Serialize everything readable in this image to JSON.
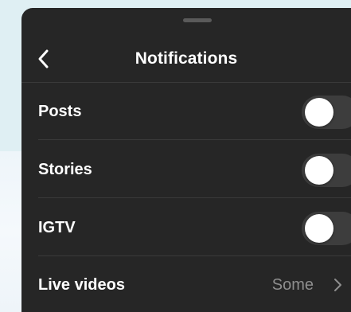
{
  "header": {
    "title": "Notifications",
    "back_icon": "chevron-left-icon"
  },
  "rows": [
    {
      "label": "Posts",
      "control": "toggle",
      "on": false
    },
    {
      "label": "Stories",
      "control": "toggle",
      "on": false
    },
    {
      "label": "IGTV",
      "control": "toggle",
      "on": false
    },
    {
      "label": "Live videos",
      "control": "disclosure",
      "value": "Some",
      "icon": "chevron-right-icon"
    }
  ],
  "colors": {
    "sheet_background": "#262626",
    "divider": "#3a3a3a",
    "toggle_off_track": "#3d3d3d",
    "toggle_knob": "#ffffff",
    "secondary_text": "#8e8e8e",
    "backdrop_top": "#dfeff3"
  }
}
